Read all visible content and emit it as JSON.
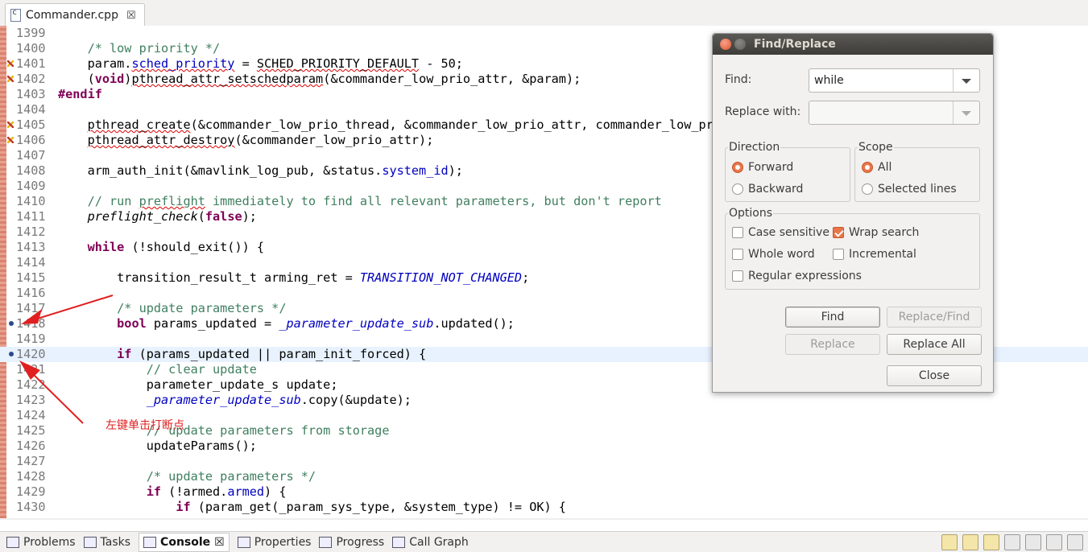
{
  "editor_tab": {
    "filename": "Commander.cpp",
    "close": "☒"
  },
  "code_lines": [
    {
      "n": "1399",
      "marker": "",
      "hl": false,
      "html": ""
    },
    {
      "n": "1400",
      "marker": "",
      "hl": false,
      "html": "    <span class='cm'>/* low priority */</span>"
    },
    {
      "n": "1401",
      "marker": "err",
      "hl": false,
      "html": "    param.<span class='field sq'>sched_priority</span> = <span class='sq'>SCHED_PRIORITY_DEFAULT</span> - 50;"
    },
    {
      "n": "1402",
      "marker": "err",
      "hl": false,
      "html": "    (<span class='kw'>void</span>)<span class='sq'>pthread_attr_setschedparam</span>(&amp;commander_low_prio_attr, &amp;param);"
    },
    {
      "n": "1403",
      "marker": "",
      "hl": false,
      "html": "<span class='kw'>#endif</span>"
    },
    {
      "n": "1404",
      "marker": "",
      "hl": false,
      "html": ""
    },
    {
      "n": "1405",
      "marker": "err",
      "hl": false,
      "html": "    <span class='sq'>pthread_create</span>(&amp;commander_low_prio_thread, &amp;commander_low_prio_attr, commander_low_prio_loop, nullptr);"
    },
    {
      "n": "1406",
      "marker": "err",
      "hl": false,
      "html": "    <span class='sq'>pthread_attr_destroy</span>(&amp;commander_low_prio_attr);"
    },
    {
      "n": "1407",
      "marker": "",
      "hl": false,
      "html": ""
    },
    {
      "n": "1408",
      "marker": "",
      "hl": false,
      "html": "    arm_auth_init(&amp;mavlink_log_pub, &amp;status.<span class='field'>system_id</span>);"
    },
    {
      "n": "1409",
      "marker": "",
      "hl": false,
      "html": ""
    },
    {
      "n": "1410",
      "marker": "",
      "hl": false,
      "html": "    <span class='cm'>// run <span class='sq'>preflight</span> immediately to find all relevant parameters, but don't report</span>"
    },
    {
      "n": "1411",
      "marker": "",
      "hl": false,
      "html": "    <span class='fn-it'>preflight_check</span>(<span class='kw'>false</span>);"
    },
    {
      "n": "1412",
      "marker": "",
      "hl": false,
      "html": ""
    },
    {
      "n": "1413",
      "marker": "",
      "hl": false,
      "html": "    <span class='kw'>while</span> (!should_exit()) {"
    },
    {
      "n": "1414",
      "marker": "",
      "hl": false,
      "html": ""
    },
    {
      "n": "1415",
      "marker": "",
      "hl": false,
      "html": "        transition_result_t arming_ret = <span class='const'>TRANSITION_NOT_CHANGED</span>;"
    },
    {
      "n": "1416",
      "marker": "",
      "hl": false,
      "html": ""
    },
    {
      "n": "1417",
      "marker": "",
      "hl": false,
      "html": "        <span class='cm'>/* update parameters */</span>"
    },
    {
      "n": "1418",
      "marker": "bp",
      "hl": false,
      "html": "        <span class='kw'>bool</span> params_updated = <span class='field fn-it'>_parameter_update_sub</span>.updated();"
    },
    {
      "n": "1419",
      "marker": "",
      "hl": false,
      "html": ""
    },
    {
      "n": "1420",
      "marker": "bp",
      "hl": true,
      "html": "        <span class='kw'>if</span> (params_updated || param_init_forced) {"
    },
    {
      "n": "1421",
      "marker": "",
      "hl": false,
      "html": "            <span class='cm'>// clear update</span>"
    },
    {
      "n": "1422",
      "marker": "",
      "hl": false,
      "html": "            parameter_update_s update;"
    },
    {
      "n": "1423",
      "marker": "",
      "hl": false,
      "html": "            <span class='field fn-it'>_parameter_update_sub</span>.copy(&amp;update);"
    },
    {
      "n": "1424",
      "marker": "",
      "hl": false,
      "html": ""
    },
    {
      "n": "1425",
      "marker": "",
      "hl": false,
      "html": "            <span class='cm'>// update parameters from storage</span>"
    },
    {
      "n": "1426",
      "marker": "",
      "hl": false,
      "html": "            updateParams();"
    },
    {
      "n": "1427",
      "marker": "",
      "hl": false,
      "html": ""
    },
    {
      "n": "1428",
      "marker": "",
      "hl": false,
      "html": "            <span class='cm'>/* update parameters */</span>"
    },
    {
      "n": "1429",
      "marker": "",
      "hl": false,
      "html": "            <span class='kw'>if</span> (!armed.<span class='field'>armed</span>) {"
    },
    {
      "n": "1430",
      "marker": "",
      "hl": false,
      "html": "                <span class='kw'>if</span> (param_get(_param_sys_type, &amp;system_type) != OK) {"
    }
  ],
  "annotation": {
    "text": "左键单击打断点",
    "color": "#e02020"
  },
  "find_dialog": {
    "title": "Find/Replace",
    "find_label": "Find:",
    "find_value": "while",
    "replace_label": "Replace with:",
    "replace_value": "",
    "direction": {
      "label": "Direction",
      "forward": "Forward",
      "backward": "Backward",
      "selected": "Forward"
    },
    "scope": {
      "label": "Scope",
      "all": "All",
      "selected_lines": "Selected lines",
      "selected": "All"
    },
    "options": {
      "label": "Options",
      "case_sensitive": "Case sensitive",
      "case_sensitive_checked": false,
      "wrap_search": "Wrap search",
      "wrap_search_checked": true,
      "whole_word": "Whole word",
      "whole_word_checked": false,
      "incremental": "Incremental",
      "incremental_checked": false,
      "regex": "Regular expressions",
      "regex_checked": false
    },
    "buttons": {
      "find": "Find",
      "replace_find": "Replace/Find",
      "replace": "Replace",
      "replace_all": "Replace All",
      "close": "Close"
    }
  },
  "bottom_views": [
    {
      "label": "Problems",
      "active": false
    },
    {
      "label": "Tasks",
      "active": false
    },
    {
      "label": "Console",
      "active": true
    },
    {
      "label": "Properties",
      "active": false
    },
    {
      "label": "Progress",
      "active": false
    },
    {
      "label": "Call Graph",
      "active": false
    }
  ],
  "colors": {
    "accent": "#e8764a",
    "keyword": "#7f0055",
    "comment": "#3f7f5f",
    "field": "#0000c0"
  }
}
